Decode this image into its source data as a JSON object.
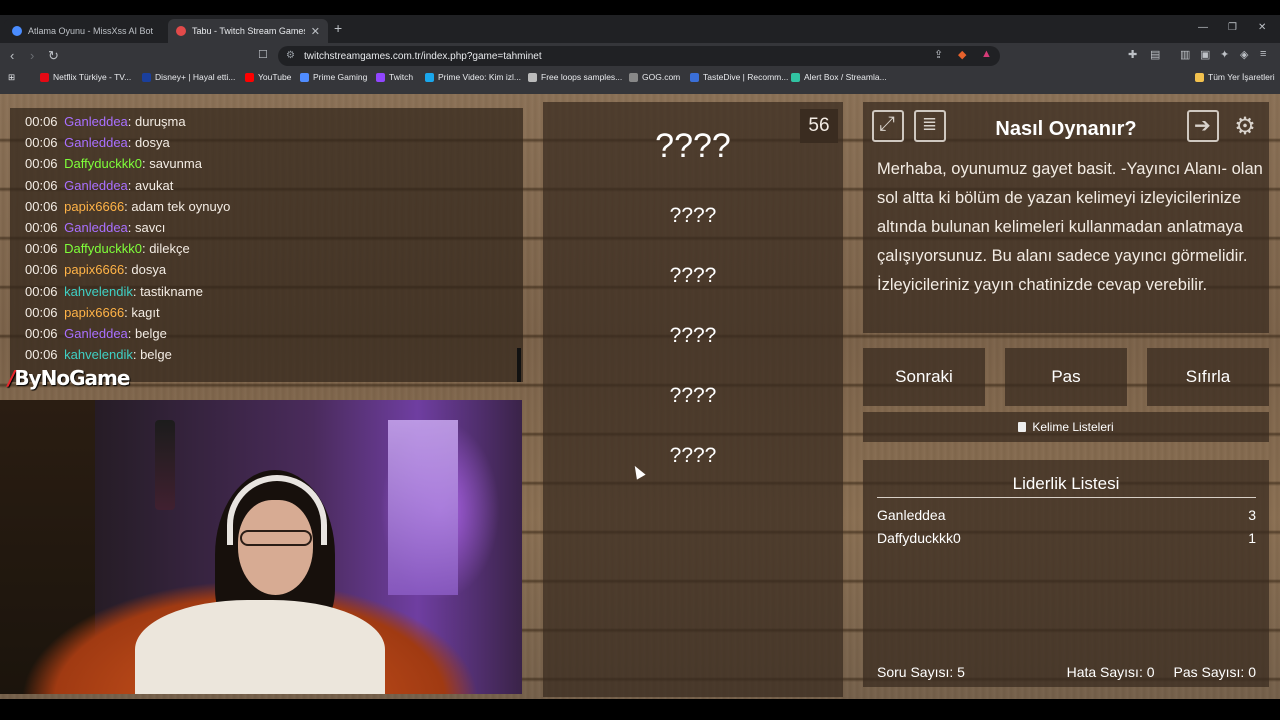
{
  "browser": {
    "tabs": [
      {
        "title": "Atlama Oyunu - MissXss AI Bot Syste",
        "active": false
      },
      {
        "title": "Tabu - Twitch Stream Games",
        "active": true
      }
    ],
    "url": "twitchstreamgames.com.tr/index.php?game=tahminet",
    "bookmarks": [
      "Netflix Türkiye - TV...",
      "Disney+ | Hayal etti...",
      "YouTube",
      "Prime Gaming",
      "Twitch",
      "Prime Video: Kim izl...",
      "Free loops samples...",
      "GOG.com",
      "TasteDive | Recomm...",
      "Alert Box / Streamla..."
    ],
    "all_bookmarks": "Tüm Yer İşaretleri"
  },
  "chat": {
    "messages": [
      {
        "time": "00:06",
        "user": "Ganleddea",
        "text": "duruşma",
        "color": "#a970ff"
      },
      {
        "time": "00:06",
        "user": "Ganleddea",
        "text": "dosya",
        "color": "#a970ff"
      },
      {
        "time": "00:06",
        "user": "Daffyduckkk0",
        "text": "savunma",
        "color": "#7fff3a"
      },
      {
        "time": "00:06",
        "user": "Ganleddea",
        "text": "avukat",
        "color": "#a970ff"
      },
      {
        "time": "00:06",
        "user": "papix6666",
        "text": "adam tek oynuyo",
        "color": "#ffb347"
      },
      {
        "time": "00:06",
        "user": "Ganleddea",
        "text": "savcı",
        "color": "#a970ff"
      },
      {
        "time": "00:06",
        "user": "Daffyduckkk0",
        "text": "dilekçe",
        "color": "#7fff3a"
      },
      {
        "time": "00:06",
        "user": "papix6666",
        "text": "dosya",
        "color": "#ffb347"
      },
      {
        "time": "00:06",
        "user": "kahvelendik",
        "text": "tastikname",
        "color": "#3fd0c4"
      },
      {
        "time": "00:06",
        "user": "papix6666",
        "text": "kagıt",
        "color": "#ffb347"
      },
      {
        "time": "00:06",
        "user": "Ganleddea",
        "text": "belge",
        "color": "#a970ff"
      },
      {
        "time": "00:06",
        "user": "kahvelendik",
        "text": "belge",
        "color": "#3fd0c4"
      }
    ],
    "logo": "ByNoGame"
  },
  "game": {
    "timer": "56",
    "main_word": "????",
    "taboo_words": [
      "????",
      "????",
      "????",
      "????",
      "????"
    ]
  },
  "howto": {
    "title": "Nasıl Oynanır?",
    "text": "Merhaba, oyunumuz gayet basit. -Yayıncı Alanı- olan sol altta ki bölüm de yazan kelimeyi izleyicilerinize altında bulunan kelimeleri kullanmadan anlatmaya çalışıyorsunuz. Bu alanı sadece yayıncı görmelidir. İzleyicileriniz yayın chatinizde cevap verebilir."
  },
  "controls": {
    "next": "Sonraki",
    "pass": "Pas",
    "reset": "Sıfırla",
    "word_lists": "Kelime Listeleri"
  },
  "leaderboard": {
    "title": "Liderlik Listesi",
    "entries": [
      {
        "name": "Ganleddea",
        "score": "3"
      },
      {
        "name": "Daffyduckkk0",
        "score": "1"
      }
    ]
  },
  "stats": {
    "questions": "Soru Sayısı: 5",
    "errors": "Hata Sayısı: 0",
    "passes": "Pas Sayısı: 0"
  }
}
